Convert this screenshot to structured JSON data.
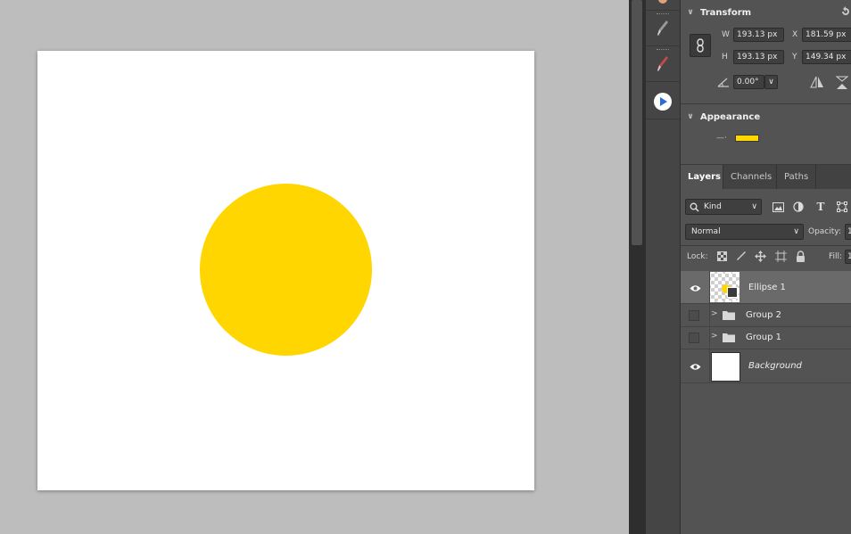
{
  "canvas": {
    "ellipse_color": "#ffd600",
    "doc_color": "#ffffff",
    "workspace_color": "#bdbdbd"
  },
  "toolstrip": {
    "tools": [
      "brush-tool-icon",
      "brush-tool-icon-2",
      "play-action-icon"
    ]
  },
  "transform": {
    "title": "Transform",
    "w_label": "W",
    "w_value": "193.13 px",
    "h_label": "H",
    "h_value": "193.13 px",
    "x_label": "X",
    "x_value": "181.59 px",
    "y_label": "Y",
    "y_value": "149.34 px",
    "angle_value": "0.00°"
  },
  "appearance": {
    "title": "Appearance",
    "stroke_label": "—·",
    "fill_color": "#ffd600"
  },
  "layers_panel": {
    "tabs": [
      "Layers",
      "Channels",
      "Paths"
    ],
    "active_tab": "Layers",
    "kind_label": "Kind",
    "blend_mode": "Normal",
    "opacity_label": "Opacity:",
    "opacity_value": "1",
    "lock_label": "Lock:",
    "fill_label": "Fill:",
    "fill_value": "1",
    "layers": [
      {
        "name": "Ellipse 1",
        "visible": true,
        "selected": true,
        "type": "shape"
      },
      {
        "name": "Group 2",
        "visible": false,
        "selected": false,
        "type": "group"
      },
      {
        "name": "Group 1",
        "visible": false,
        "selected": false,
        "type": "group"
      },
      {
        "name": "Background",
        "visible": true,
        "selected": false,
        "type": "background"
      }
    ]
  }
}
